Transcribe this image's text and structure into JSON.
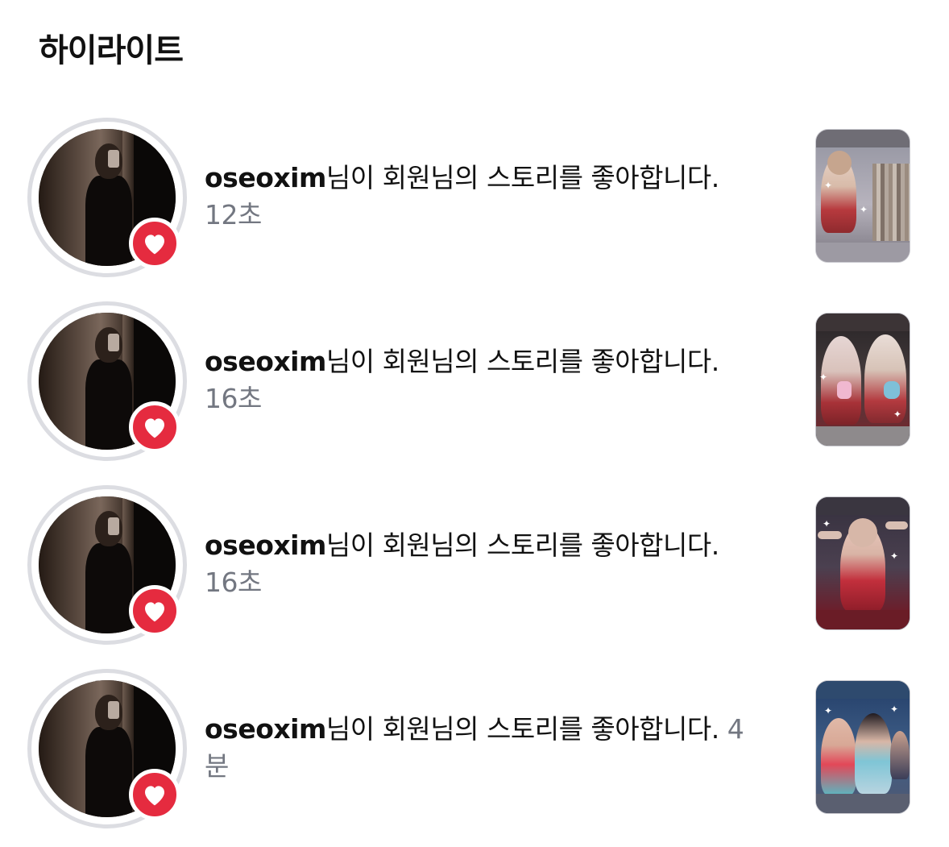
{
  "section": {
    "title": "하이라이트"
  },
  "notifications": [
    {
      "username": "oseoxim",
      "message": "님이 회원님의 스토리를 좋아합니다.",
      "time": "12초"
    },
    {
      "username": "oseoxim",
      "message": "님이 회원님의 스토리를 좋아합니다.",
      "time": "16초"
    },
    {
      "username": "oseoxim",
      "message": "님이 회원님의 스토리를 좋아합니다.",
      "time": "16초"
    },
    {
      "username": "oseoxim",
      "message": "님이 회원님의 스토리를 좋아합니다.",
      "time": "4분"
    }
  ],
  "colors": {
    "heart_badge": "#e52b3f",
    "avatar_ring": "#dcdde2",
    "time_text": "#737781"
  },
  "icons": {
    "badge": "heart-icon"
  }
}
